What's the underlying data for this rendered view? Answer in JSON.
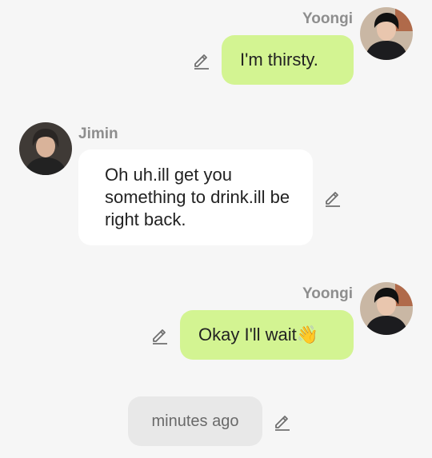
{
  "messages": [
    {
      "sender": "Yoongi",
      "text": "I'm thirsty.",
      "side": "right"
    },
    {
      "sender": "Jimin",
      "text": "Oh uh.ill get you something to drink.ill be right back.",
      "side": "left"
    },
    {
      "sender": "Yoongi",
      "text": "Okay I'll wait👋",
      "side": "right"
    }
  ],
  "timestamp": "minutes ago",
  "colors": {
    "background": "#f6f6f6",
    "outgoing_bubble": "#d3f492",
    "incoming_bubble": "#ffffff",
    "timestamp_bubble": "#e8e8e8",
    "name_text": "#8e8e8e"
  },
  "icons": {
    "edit": "pencil-edit-icon"
  }
}
